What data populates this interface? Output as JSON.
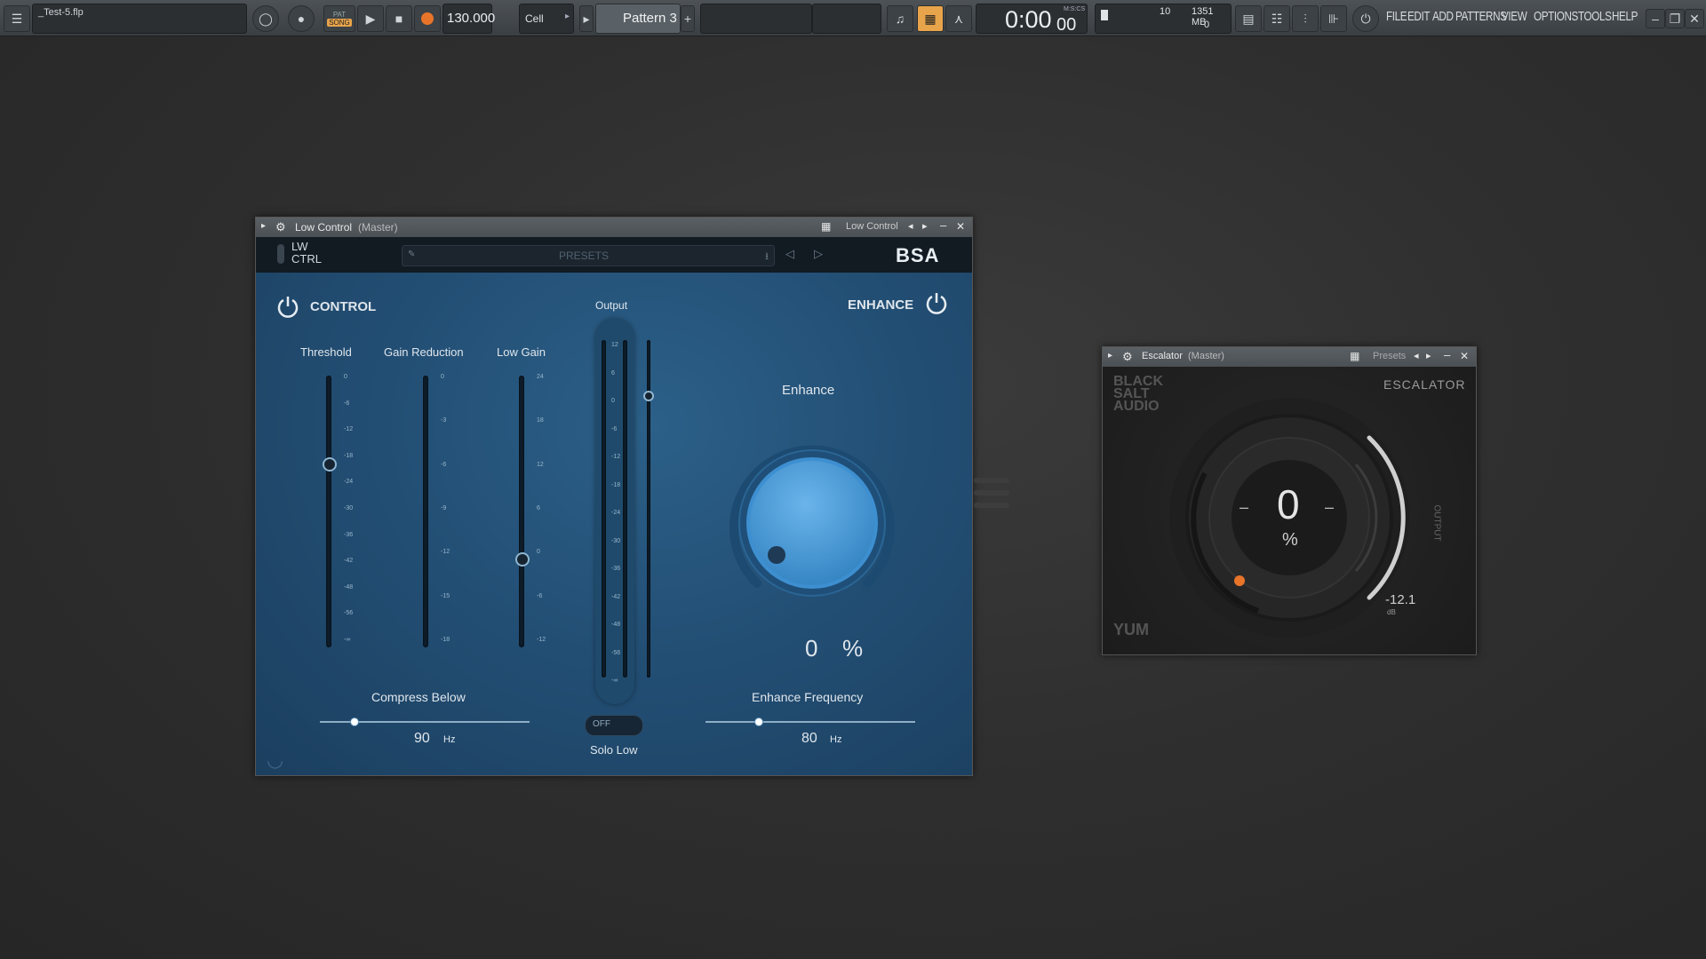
{
  "topbar": {
    "project_title": "_Test-5.flp",
    "pat_label": "PAT",
    "song_label": "SONG",
    "tempo": "130.000",
    "snap": "Cell",
    "pattern": "Pattern 3",
    "time": "0:00",
    "time_sub": "00",
    "time_unit": "M:S:CS",
    "cpu_voices": "10",
    "memory": "1351 MB",
    "memory_sub": "0",
    "menu": [
      "FILE",
      "EDIT",
      "ADD",
      "PATTERNS",
      "VIEW",
      "OPTIONS",
      "TOOLS",
      "HELP"
    ]
  },
  "lowcontrol": {
    "window_title": "Low Control",
    "window_title_sub": "(Master)",
    "title_right": "Low Control",
    "logo_line1": "LW",
    "logo_line2": "CTRL",
    "presets": "PRESETS",
    "brand": "BSA",
    "control_label": "CONTROL",
    "enhance_label": "ENHANCE",
    "threshold_label": "Threshold",
    "gain_reduction_label": "Gain Reduction",
    "low_gain_label": "Low Gain",
    "output_label": "Output",
    "enhance_knob_label": "Enhance",
    "enhance_value": "0",
    "enhance_unit": "%",
    "threshold_ticks": [
      "0",
      "-6",
      "-12",
      "-18",
      "-24",
      "-30",
      "-36",
      "-42",
      "-48",
      "-56",
      "-∞"
    ],
    "gr_ticks": [
      "0",
      "-3",
      "-6",
      "-9",
      "-12",
      "-15",
      "-18"
    ],
    "lowgain_ticks": [
      "24",
      "18",
      "12",
      "6",
      "0",
      "-6",
      "-12"
    ],
    "output_ticks": [
      "12",
      "6",
      "0",
      "-6",
      "-12",
      "-18",
      "-24",
      "-30",
      "-36",
      "-42",
      "-48",
      "-56",
      "-∞"
    ],
    "threshold_level": 0.32,
    "low_gain_level": 0.33,
    "compress_below_label": "Compress Below",
    "compress_below_value": "90",
    "compress_below_unit": "Hz",
    "compress_below_level": 0.16,
    "solo_low_toggle": "OFF",
    "solo_low_label": "Solo Low",
    "enhance_freq_label": "Enhance Frequency",
    "enhance_freq_value": "80",
    "enhance_freq_unit": "Hz",
    "enhance_freq_level": 0.25
  },
  "escalator": {
    "window_title": "Escalator",
    "window_title_sub": "(Master)",
    "presets": "Presets",
    "brand_l1": "BLACK",
    "brand_l2": "SALT",
    "brand_l3": "AUDIO",
    "product": "ESCALATOR",
    "value": "0",
    "unit": "%",
    "minus_left": "–",
    "minus_right": "–",
    "output_label": "OUTPUT",
    "output_value": "-12.1",
    "output_unit": "dB",
    "footer_logo": "YUM"
  },
  "colors": {
    "accent_orange": "#e8742a",
    "knob_blue": "#4a9fd8",
    "record_orange": "#e8742a"
  }
}
